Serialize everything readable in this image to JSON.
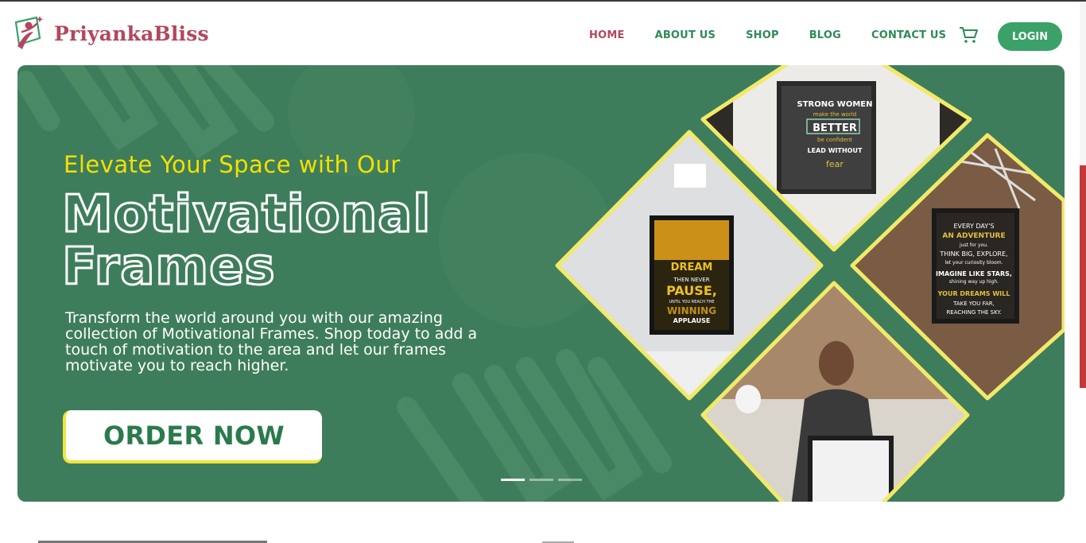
{
  "brand": {
    "name": "PriyankaBliss",
    "logo_icon": "person-star-logo"
  },
  "nav": {
    "items": [
      {
        "label": "HOME",
        "active": true
      },
      {
        "label": "ABOUT US",
        "active": false
      },
      {
        "label": "SHOP",
        "active": false
      },
      {
        "label": "BLOG",
        "active": false
      },
      {
        "label": "CONTACT US",
        "active": false
      }
    ],
    "cart_icon": "shopping-cart-icon",
    "login_label": "LOGIN"
  },
  "hero": {
    "tagline": "Elevate Your Space with Our",
    "title_line1": "Motivational",
    "title_line2": "Frames",
    "description": "Transform the world around you with our amazing collection of Motivational Frames. Shop today to add a touch of motivation to the area and let our frames motivate you to reach higher.",
    "cta_label": "ORDER NOW",
    "slides": 3,
    "active_slide": 1,
    "frames": {
      "top": {
        "line1": "STRONG WOMEN",
        "line2": "make the world",
        "line3": "BETTER",
        "line4": "be confident",
        "line5": "LEAD WITHOUT",
        "line6": "fear"
      },
      "left": {
        "line1": "DREAM",
        "line2": "THEN NEVER",
        "line3": "PAUSE,",
        "line4": "UNTIL YOU REACH THE",
        "line5": "WINNING",
        "line6": "APPLAUSE"
      },
      "right": {
        "line1": "EVERY DAY'S",
        "line2": "AN ADVENTURE",
        "line3": "just for you.",
        "line4": "THINK BIG, EXPLORE,",
        "line5": "let your curiosity bloom.",
        "line6": "IMAGINE LIKE STARS,",
        "line7": "shining way up high.",
        "line8": "YOUR DREAMS WILL",
        "line9": "TAKE YOU FAR,",
        "line10": "REACHING THE SKY."
      }
    }
  },
  "colors": {
    "brand": "#b3475e",
    "green": "#3e7d5b",
    "accent_yellow": "#f3e000",
    "login_bg": "#3aa168"
  }
}
